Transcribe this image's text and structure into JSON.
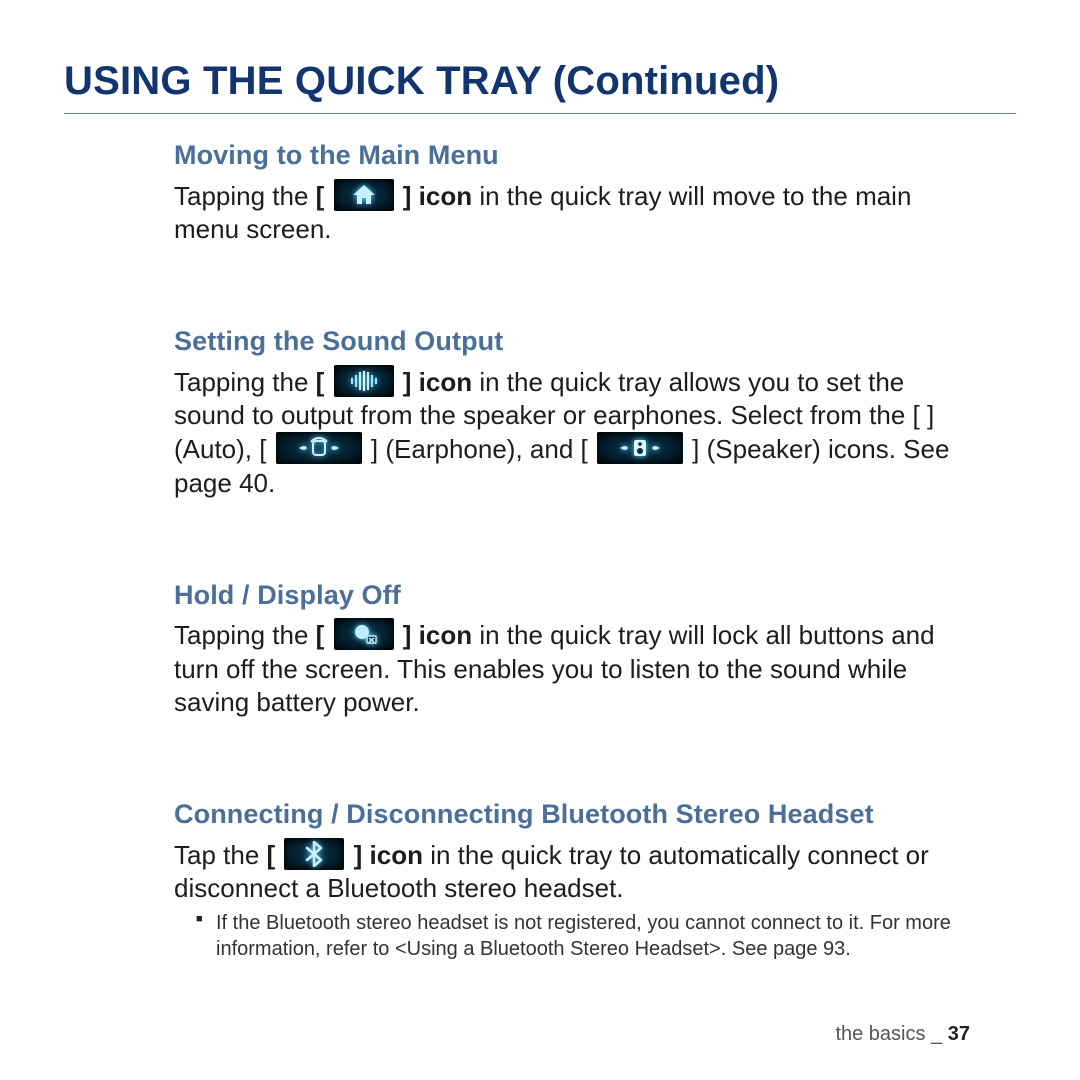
{
  "page_title": "USING THE QUICK TRAY (Continued)",
  "sections": {
    "s1": {
      "heading": "Moving to the Main Menu",
      "pre": "Tapping the ",
      "bracket_open": "[ ",
      "bracket_close": " ] icon",
      "post": " in the quick tray will move to the main menu screen."
    },
    "s2": {
      "heading": "Setting the Sound Output",
      "pre": "Tapping the ",
      "bracket_open": "[ ",
      "bracket_close": " ] icon",
      "t_mid1": " in the quick tray allows you to set the sound to output from the speaker or earphones. Select from the [            ] (Auto), [ ",
      "t_mid2": " ] (Earphone), and [ ",
      "t_mid3": " ] (Speaker) icons. See page 40."
    },
    "s3": {
      "heading": "Hold / Display Off",
      "pre": "Tapping the ",
      "bracket_open": "[ ",
      "bracket_close": " ] icon",
      "post": " in the quick tray will lock all buttons and turn off the screen. This enables you to listen to the sound while saving battery power."
    },
    "s4": {
      "heading": "Connecting / Disconnecting Bluetooth Stereo Headset",
      "pre": "Tap the ",
      "bracket_open": "[ ",
      "bracket_close": " ] icon",
      "post": " in the quick tray to automatically connect or disconnect a Bluetooth stereo headset.",
      "note": "If the Bluetooth stereo headset is not registered, you cannot connect to it. For more information, refer to <Using a Bluetooth Stereo Headset>. See page 93."
    }
  },
  "footer": {
    "section": "the basics",
    "sep": " _ ",
    "page": "37"
  }
}
